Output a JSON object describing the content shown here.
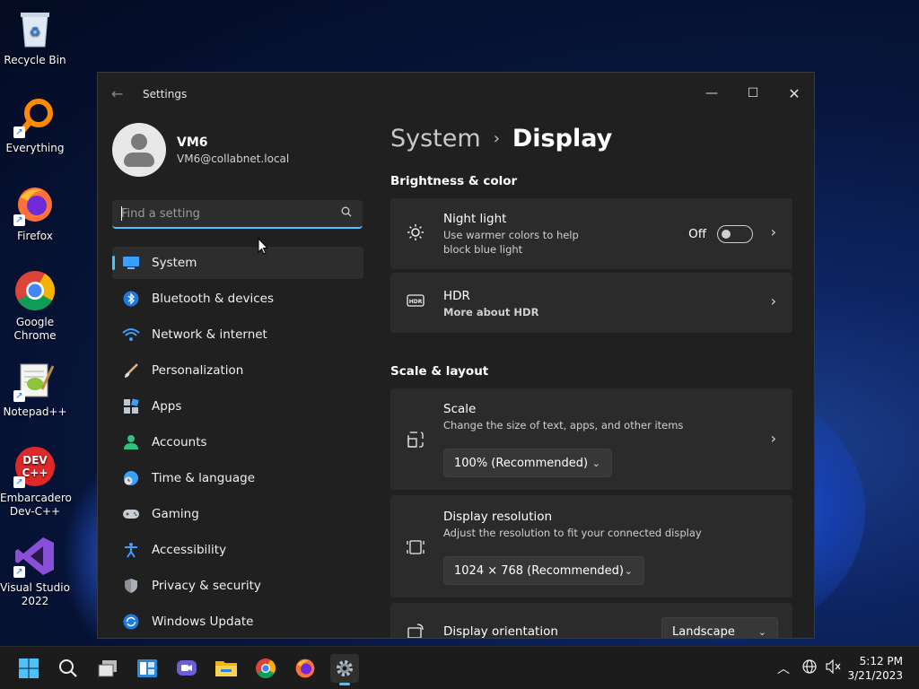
{
  "desktop": {
    "icons": [
      {
        "label": "Recycle Bin",
        "icon": "recycle-bin-icon"
      },
      {
        "label": "Everything",
        "icon": "search-app-icon"
      },
      {
        "label": "Firefox",
        "icon": "firefox-icon"
      },
      {
        "label": "Google Chrome",
        "icon": "chrome-icon"
      },
      {
        "label": "Notepad++",
        "icon": "notepad-icon"
      },
      {
        "label": "Embarcadero Dev-C++",
        "icon": "devcpp-icon"
      },
      {
        "label": "Visual Studio 2022",
        "icon": "visual-studio-icon"
      }
    ],
    "devcpp_logo_text": "DEV C++"
  },
  "window": {
    "title": "Settings",
    "minimize": "—",
    "maximize": "☐",
    "close": "✕"
  },
  "profile": {
    "name": "VM6",
    "email": "VM6@collabnet.local"
  },
  "search": {
    "placeholder": "Find a setting"
  },
  "nav": [
    {
      "label": "System",
      "active": true
    },
    {
      "label": "Bluetooth & devices"
    },
    {
      "label": "Network & internet"
    },
    {
      "label": "Personalization"
    },
    {
      "label": "Apps"
    },
    {
      "label": "Accounts"
    },
    {
      "label": "Time & language"
    },
    {
      "label": "Gaming"
    },
    {
      "label": "Accessibility"
    },
    {
      "label": "Privacy & security"
    },
    {
      "label": "Windows Update"
    }
  ],
  "breadcrumb": {
    "parent": "System",
    "current": "Display"
  },
  "sections": {
    "brightness": "Brightness & color",
    "scale_layout": "Scale & layout"
  },
  "night_light": {
    "title": "Night light",
    "desc_line1": "Use warmer colors to help",
    "desc_line2": "block blue light",
    "state": "Off"
  },
  "hdr": {
    "title": "HDR",
    "icon_text": "HDR",
    "link": "More about HDR"
  },
  "scale": {
    "title": "Scale",
    "desc": "Change the size of text, apps, and other items",
    "value": "100% (Recommended)"
  },
  "resolution": {
    "title": "Display resolution",
    "desc": "Adjust the resolution to fit your connected display",
    "value": "1024 × 768 (Recommended)"
  },
  "orientation": {
    "title": "Display orientation",
    "value": "Landscape"
  },
  "taskbar": {
    "time": "5:12 PM",
    "date": "3/21/2023"
  },
  "colors": {
    "accent": "#4cc2ff",
    "window_bg": "#202020",
    "card_bg": "#2b2b2b"
  }
}
